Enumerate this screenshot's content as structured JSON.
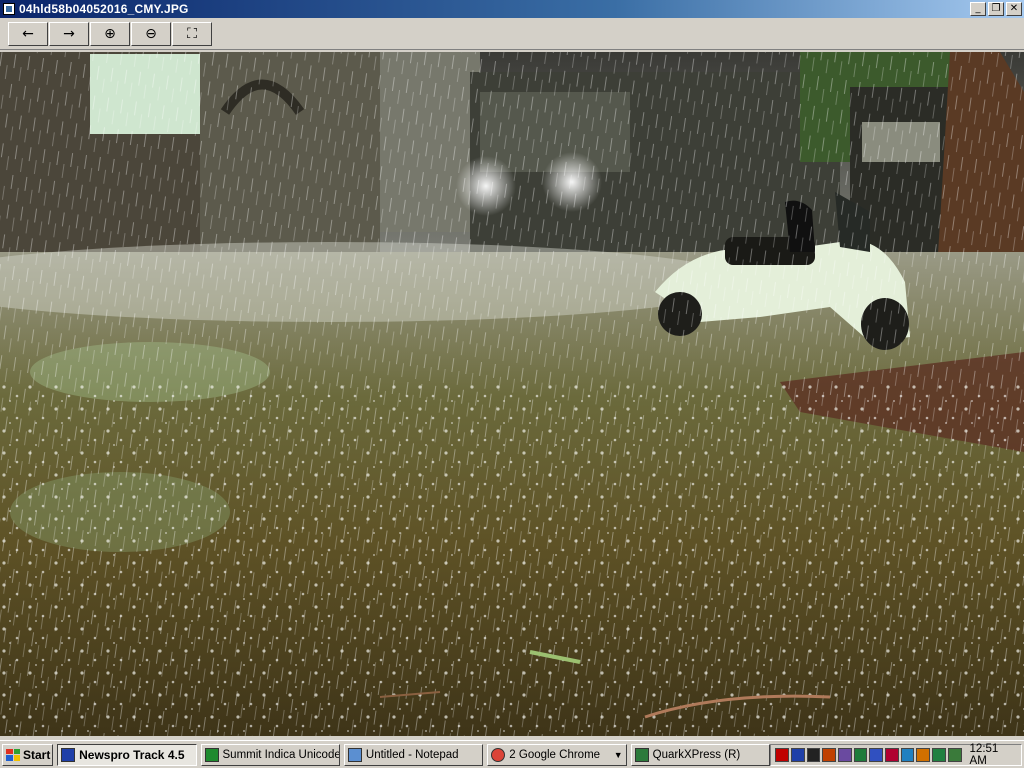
{
  "window": {
    "title": "04hld58b04052016_CMY.JPG",
    "minimize_glyph": "_",
    "restore_glyph": "❐",
    "close_glyph": "✕"
  },
  "toolbar": {
    "buttons": [
      {
        "name": "previous-image",
        "icon": "arrow-left-icon",
        "glyph": "←"
      },
      {
        "name": "next-image",
        "icon": "arrow-right-icon",
        "glyph": "→"
      },
      {
        "name": "zoom-in",
        "icon": "zoom-in-icon",
        "glyph": "⊕"
      },
      {
        "name": "zoom-out",
        "icon": "zoom-out-icon",
        "glyph": "⊖"
      },
      {
        "name": "best-fit",
        "icon": "fit-window-icon",
        "glyph": "⛶"
      }
    ]
  },
  "taskbar": {
    "start_label": "Start",
    "tasks": [
      {
        "label": "Newspro Track 4.5",
        "icon": "newspro-icon",
        "color": "#1f3fa8",
        "active": true
      },
      {
        "label": "Summit Indica Unicode",
        "icon": "summit-icon",
        "color": "#1e8a2e",
        "active": false
      },
      {
        "label": "Untitled - Notepad",
        "icon": "notepad-icon",
        "color": "#5b8fd1",
        "active": false
      },
      {
        "label": "2 Google Chrome",
        "icon": "chrome-icon",
        "color": "#db4437",
        "active": false,
        "grouped": true
      },
      {
        "label": "QuarkXPress (R)",
        "icon": "quark-icon",
        "color": "#2c7a3b",
        "active": false
      }
    ],
    "tray_icons": [
      "#c00000",
      "#1f3fa8",
      "#222222",
      "#c04000",
      "#6a4aa0",
      "#1e7b3a",
      "#3050c0",
      "#b00030",
      "#2080c0",
      "#d07000",
      "#208040",
      "#3a7a3a"
    ],
    "clock": "12:51 AM"
  }
}
